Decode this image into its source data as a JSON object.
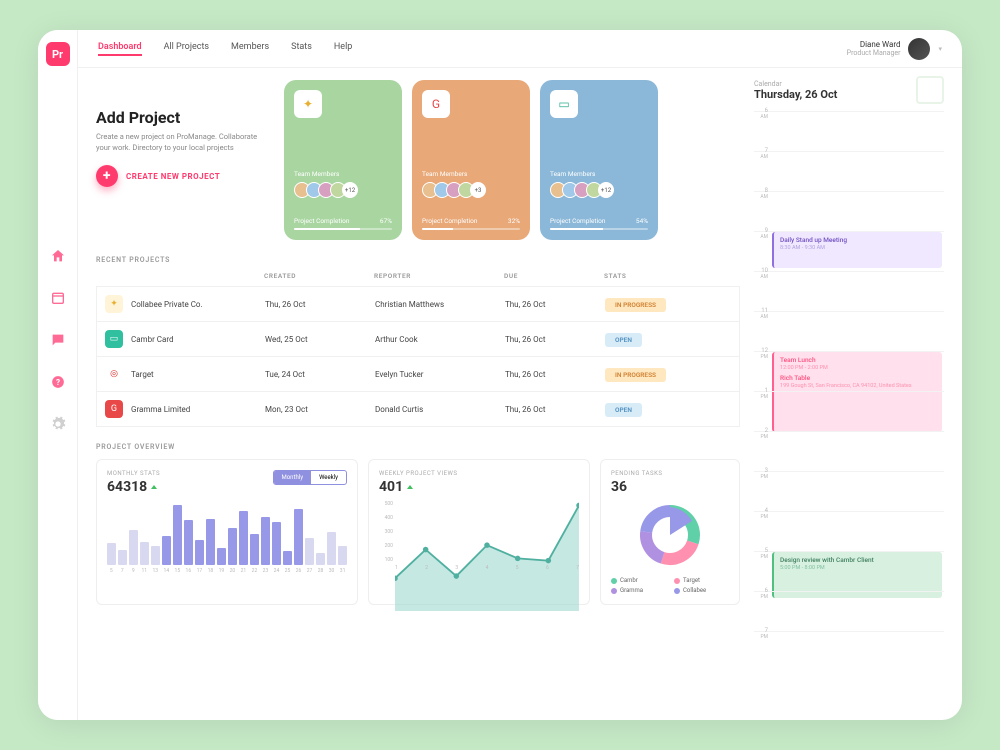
{
  "app_logo": "Pr",
  "nav": {
    "items": [
      "Dashboard",
      "All Projects",
      "Members",
      "Stats",
      "Help"
    ],
    "active": 0
  },
  "user": {
    "name": "Diane Ward",
    "role": "Product Manager"
  },
  "hero": {
    "title": "Add Project",
    "subtitle": "Create a new project on ProManage. Collaborate your work. Directory to your local projects",
    "button": "CREATE NEW PROJECT"
  },
  "project_cards": [
    {
      "color": "green",
      "team_label": "Team Members",
      "extra": "+12",
      "completion_label": "Project Completion",
      "pct": "67%",
      "pct_val": 67
    },
    {
      "color": "orange",
      "team_label": "Team Members",
      "extra": "+3",
      "completion_label": "Project Completion",
      "pct": "32%",
      "pct_val": 32
    },
    {
      "color": "blue",
      "team_label": "Team Members",
      "extra": "+12",
      "completion_label": "Project Completion",
      "pct": "54%",
      "pct_val": 54
    }
  ],
  "table": {
    "section": "RECENT PROJECTS",
    "headers": {
      "created": "CREATED",
      "reporter": "REPORTER",
      "due": "DUE",
      "stats": "STATS"
    },
    "rows": [
      {
        "name": "Collabee Private Co.",
        "created": "Thu, 26 Oct",
        "reporter": "Christian Matthews",
        "due": "Thu, 26 Oct",
        "status": "IN PROGRESS",
        "status_class": "prog",
        "ico_bg": "#fff4d8",
        "ico_fg": "#e8b030",
        "glyph": "✦"
      },
      {
        "name": "Cambr Card",
        "created": "Wed, 25 Oct",
        "reporter": "Arthur Cook",
        "due": "Thu, 26 Oct",
        "status": "OPEN",
        "status_class": "open",
        "ico_bg": "#30c0a0",
        "ico_fg": "#fff",
        "glyph": "▭"
      },
      {
        "name": "Target",
        "created": "Tue, 24 Oct",
        "reporter": "Evelyn Tucker",
        "due": "Thu, 26 Oct",
        "status": "IN PROGRESS",
        "status_class": "prog",
        "ico_bg": "#fff",
        "ico_fg": "#e02020",
        "glyph": "◎"
      },
      {
        "name": "Gramma Limited",
        "created": "Mon, 23 Oct",
        "reporter": "Donald Curtis",
        "due": "Thu, 26 Oct",
        "status": "OPEN",
        "status_class": "open",
        "ico_bg": "#e84848",
        "ico_fg": "#fff",
        "glyph": "G"
      }
    ]
  },
  "overview": {
    "section": "PROJECT OVERVIEW",
    "monthly": {
      "label": "MONTHLY STATS",
      "value": "64318",
      "toggle": [
        "Monthly",
        "Weekly"
      ],
      "toggle_active": 0
    },
    "weekly": {
      "label": "WEEKLY PROJECT VIEWS",
      "value": "401"
    },
    "pending": {
      "label": "PENDING TASKS",
      "value": "36",
      "legend": [
        {
          "name": "Cambr",
          "color": "#60d0a8"
        },
        {
          "name": "Target",
          "color": "#ff90b0"
        },
        {
          "name": "Gramma",
          "color": "#b090e0"
        },
        {
          "name": "Collabee",
          "color": "#9898e8"
        }
      ]
    }
  },
  "calendar": {
    "label": "Calendar",
    "date": "Thursday, 26 Oct",
    "hours": [
      {
        "n": "6",
        "ap": "AM"
      },
      {
        "n": "7",
        "ap": "AM"
      },
      {
        "n": "8",
        "ap": "AM"
      },
      {
        "n": "9",
        "ap": "AM"
      },
      {
        "n": "10",
        "ap": "AM"
      },
      {
        "n": "11",
        "ap": "AM"
      },
      {
        "n": "12",
        "ap": "PM"
      },
      {
        "n": "1",
        "ap": "PM"
      },
      {
        "n": "2",
        "ap": "PM"
      },
      {
        "n": "3",
        "ap": "PM"
      },
      {
        "n": "4",
        "ap": "PM"
      },
      {
        "n": "5",
        "ap": "PM"
      },
      {
        "n": "6",
        "ap": "PM"
      },
      {
        "n": "7",
        "ap": "PM"
      }
    ],
    "events": [
      {
        "title": "Daily Stand up Meeting",
        "time": "8:30 AM - 9:30 AM",
        "class": "ev1",
        "slot": 3
      },
      {
        "title": "Team Lunch",
        "time": "12:00 PM - 2:00 PM",
        "loc_name": "Rich Table",
        "loc_addr": "199 Gough St, San Francisco, CA 94102, United States",
        "class": "ev2",
        "slot": 6
      },
      {
        "title": "Design review with Cambr Client",
        "time": "5:00 PM - 8:00 PM",
        "class": "ev3",
        "slot": 11
      }
    ]
  },
  "chart_data": [
    {
      "type": "bar",
      "title": "MONTHLY STATS",
      "x": [
        5,
        7,
        9,
        11,
        13,
        14,
        15,
        16,
        17,
        18,
        19,
        20,
        21,
        22,
        23,
        24,
        25,
        26,
        27,
        28,
        30,
        31
      ],
      "values": [
        28,
        20,
        45,
        30,
        25,
        38,
        78,
        58,
        32,
        60,
        22,
        48,
        70,
        40,
        62,
        55,
        18,
        72,
        35,
        15,
        42,
        25
      ],
      "highlight_range": [
        14,
        26
      ],
      "ylim": [
        0,
        80
      ]
    },
    {
      "type": "area",
      "title": "WEEKLY PROJECT VIEWS",
      "x": [
        1,
        2,
        3,
        4,
        5,
        6,
        7
      ],
      "values": [
        150,
        280,
        160,
        300,
        240,
        230,
        480
      ],
      "ylabel": "",
      "y_ticks": [
        100,
        200,
        300,
        400,
        500
      ],
      "ylim": [
        0,
        500
      ]
    },
    {
      "type": "pie",
      "title": "PENDING TASKS",
      "series": [
        {
          "name": "Cambr",
          "value": 30,
          "color": "#60d0a8"
        },
        {
          "name": "Target",
          "value": 25,
          "color": "#ff90b0"
        },
        {
          "name": "Gramma",
          "value": 22,
          "color": "#b090e0"
        },
        {
          "name": "Collabee",
          "value": 23,
          "color": "#9898e8"
        }
      ]
    }
  ]
}
